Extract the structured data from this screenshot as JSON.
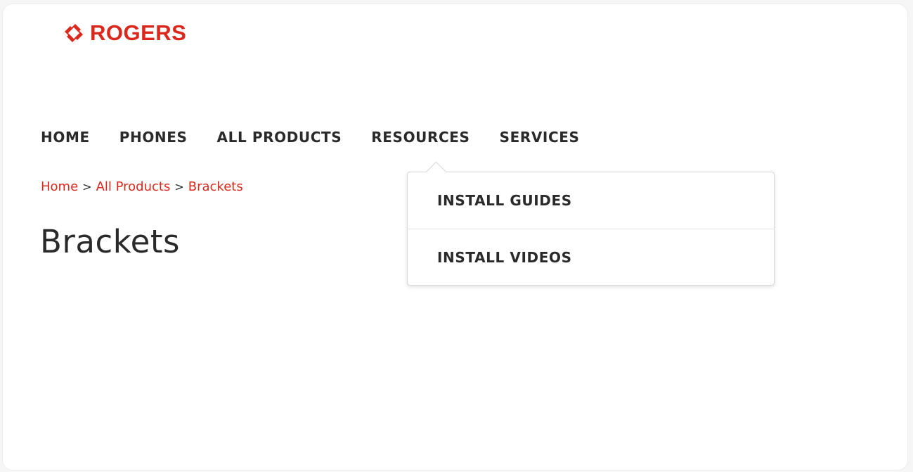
{
  "brand": {
    "name": "ROGERS",
    "color": "#da291c",
    "icon": "rogers-swirl-logo-icon"
  },
  "nav": {
    "items": [
      {
        "label": "HOME"
      },
      {
        "label": "PHONES"
      },
      {
        "label": "ALL PRODUCTS"
      },
      {
        "label": "RESOURCES"
      },
      {
        "label": "SERVICES"
      }
    ]
  },
  "resources_menu": {
    "items": [
      {
        "label": "INSTALL GUIDES"
      },
      {
        "label": "INSTALL VIDEOS"
      }
    ]
  },
  "breadcrumb": {
    "items": [
      {
        "label": "Home"
      },
      {
        "label": "All Products"
      },
      {
        "label": "Brackets"
      }
    ],
    "separator": ">"
  },
  "page": {
    "title": "Brackets"
  }
}
